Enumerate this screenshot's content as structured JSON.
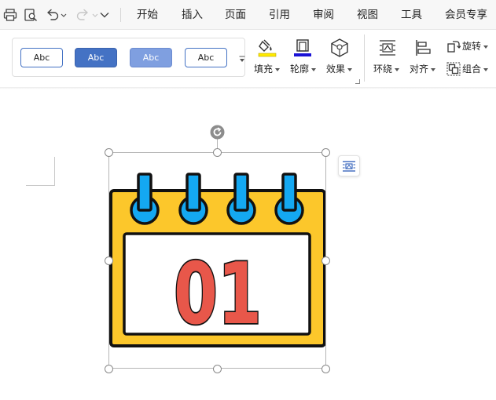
{
  "quick_access": {
    "print": "print-icon",
    "print_preview": "print-preview-icon",
    "undo": "undo-icon",
    "redo": "redo-icon",
    "customize": "chevron-down-icon"
  },
  "menu": {
    "items": [
      "开始",
      "插入",
      "页面",
      "引用",
      "审阅",
      "视图",
      "工具",
      "会员专享"
    ]
  },
  "ribbon": {
    "style_gallery": {
      "styles": [
        "Abc",
        "Abc",
        "Abc",
        "Abc"
      ]
    },
    "fill_label": "填充",
    "outline_label": "轮廓",
    "effects_label": "效果",
    "wrap_label": "环绕",
    "align_label": "对齐",
    "rotate_label": "旋转",
    "group_label": "组合",
    "fill_color": "#ffea00",
    "outline_color": "#1a12d6"
  },
  "shape": {
    "number_text": "01",
    "frame_color": "#fcc72b",
    "ring_color": "#14a8f2",
    "number_color": "#e8574a",
    "outline_color": "#111111"
  }
}
